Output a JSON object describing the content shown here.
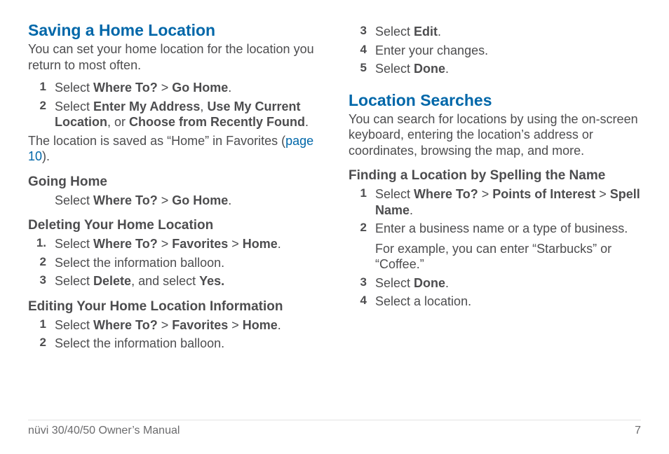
{
  "left": {
    "h1": "Saving a Home Location",
    "intro": "You can set your home location for the location you return to most often.",
    "steps1": [
      {
        "n": "1",
        "pre": "Select ",
        "b1": "Where To?",
        "mid": " > ",
        "b2": "Go Home",
        "post": "."
      },
      {
        "n": "2",
        "pre": "Select ",
        "b1": "Enter My Address",
        "mid": ", ",
        "b2": "Use My Current Location",
        "mid2": ", or ",
        "b3": "Choose from Recently Found",
        "post": "."
      }
    ],
    "savedNote_pre": "The location is saved as “Home” in Favorites (",
    "savedNote_link": "page 10",
    "savedNote_post": ").",
    "sub_going": "Going Home",
    "going_line_pre": "Select ",
    "going_b1": "Where To?",
    "going_mid": " > ",
    "going_b2": "Go Home",
    "going_post": ".",
    "sub_delete": "Deleting Your Home Location",
    "del_steps": [
      {
        "n": "1.",
        "pre": "Select ",
        "b1": "Where To?",
        "mid": " > ",
        "b2": "Favorites",
        "mid2": " > ",
        "b3": "Home",
        "post": "."
      },
      {
        "n": "2",
        "txt": "Select the information balloon."
      },
      {
        "n": "3",
        "pre": "Select ",
        "b1": "Delete",
        "mid": ", and select ",
        "b2": "Yes.",
        "post": ""
      }
    ],
    "sub_edit": "Editing Your Home Location Information",
    "edit_steps": [
      {
        "n": "1",
        "pre": "Select ",
        "b1": "Where To?",
        "mid": " > ",
        "b2": "Favorites",
        "mid2": " > ",
        "b3": "Home",
        "post": "."
      },
      {
        "n": "2",
        "txt": "Select the information balloon."
      }
    ]
  },
  "right": {
    "cont_steps": [
      {
        "n": "3",
        "pre": "Select ",
        "b1": "Edit",
        "post": "."
      },
      {
        "n": "4",
        "txt": "Enter your changes."
      },
      {
        "n": "5",
        "pre": "Select ",
        "b1": "Done",
        "post": "."
      }
    ],
    "h1": "Location Searches",
    "intro": "You can search for locations by using the on-screen keyboard, entering the location’s address or coordinates, browsing the map, and more.",
    "sub_find": "Finding a Location by Spelling the Name",
    "find_steps": [
      {
        "n": "1",
        "pre": "Select ",
        "b1": "Where To?",
        "mid": " > ",
        "b2": "Points of Interest",
        "mid2": " > ",
        "b3": "Spell Name",
        "post": "."
      },
      {
        "n": "2",
        "txt": "Enter a business name or a type of business.",
        "sub": "For example, you can enter “Starbucks” or “Coffee.”"
      },
      {
        "n": "3",
        "pre": "Select ",
        "b1": "Done",
        "post": "."
      },
      {
        "n": "4",
        "txt": "Select a location."
      }
    ]
  },
  "footer": {
    "left": "nüvi 30/40/50 Owner’s Manual",
    "right": "7"
  }
}
